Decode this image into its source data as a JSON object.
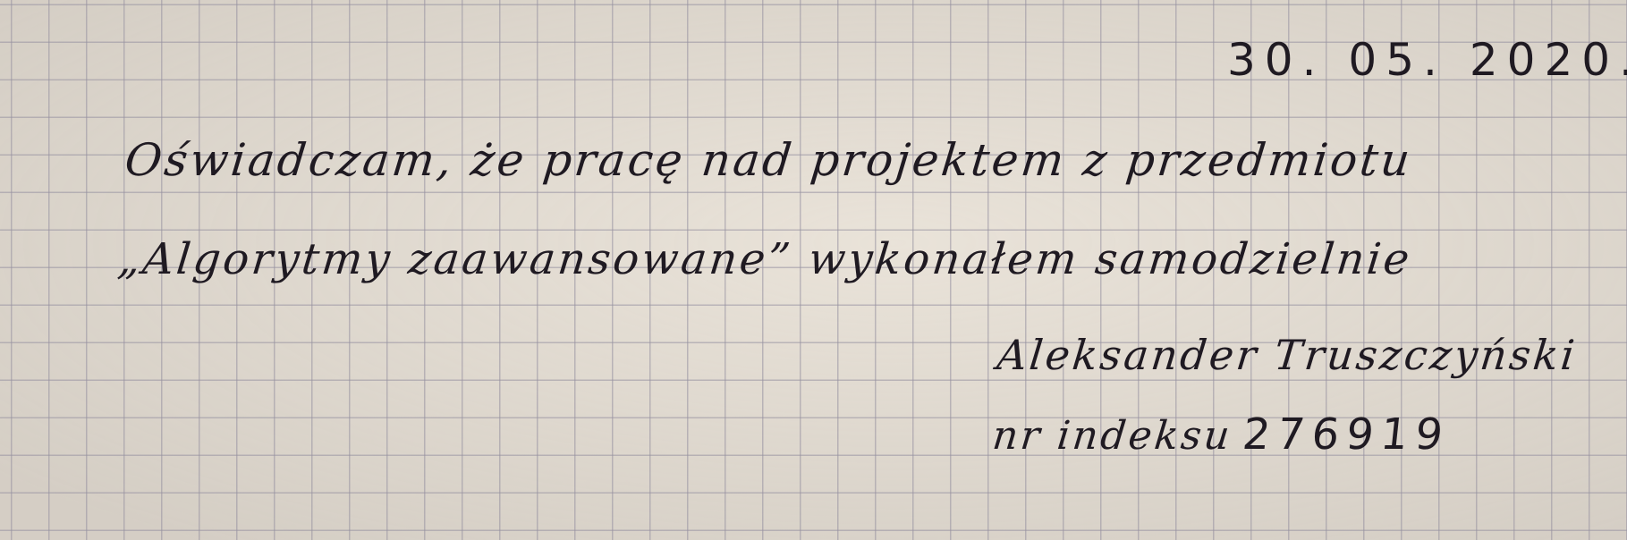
{
  "document": {
    "date": "30. 05. 2020.",
    "statement_line_1": "Oświadczam, że pracę nad projektem z przedmiotu",
    "statement_line_2": "„Algorytmy zaawansowane” wykonałem samodzielnie",
    "signature_name": "Aleksander Truszczyński",
    "index_label": "nr indeksu",
    "index_number": "276919"
  }
}
